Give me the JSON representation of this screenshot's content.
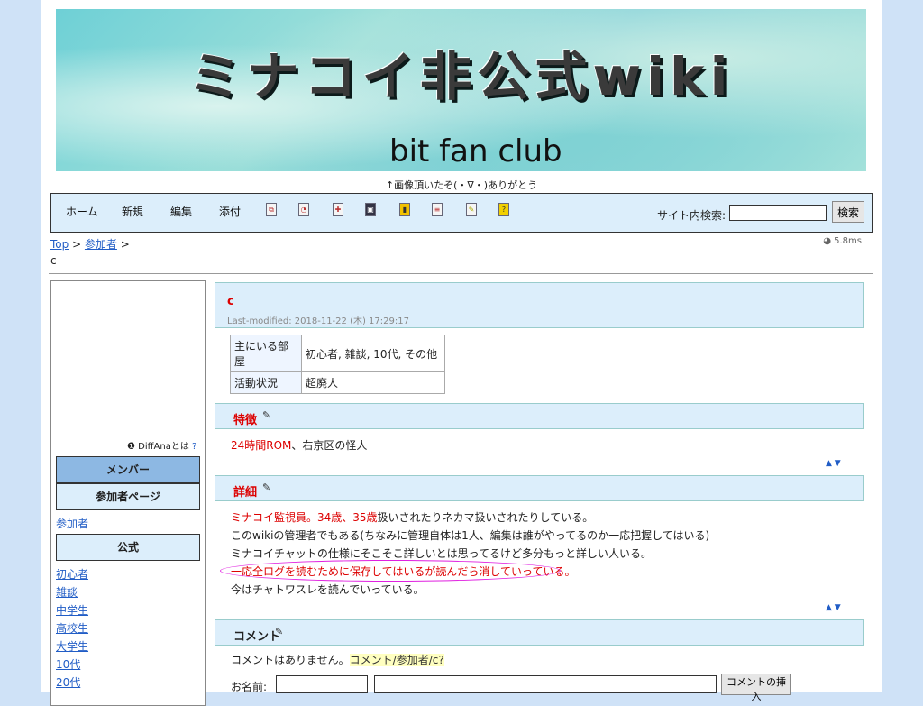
{
  "banner": {
    "title": "ミナコイ非公式wiki",
    "subtitle": "bit fan club",
    "caption": "↑画像頂いたぞ(・∇・)ありがとう"
  },
  "nav": {
    "links": [
      "ホーム",
      "新規",
      "編集",
      "添付"
    ],
    "icons": [
      "copy-icon",
      "find-icon",
      "diff-icon",
      "save-icon",
      "lock-icon",
      "list-icon",
      "recent-icon",
      "help-icon"
    ],
    "search_label": "サイト内検索:",
    "search_value": "",
    "search_button": "検索"
  },
  "breadcrumb": {
    "top": "Top",
    "sep": " > ",
    "parent": "参加者",
    "trail": " >"
  },
  "page_short": "c",
  "render_time": "5.8ms",
  "sidebar": {
    "diffana": "DiffAnaとは",
    "diffana_q": "?",
    "members_head": "メンバー",
    "members_page": "参加者ページ",
    "participant_link": "参加者",
    "official_head": "公式",
    "links": [
      "初心者",
      "雑談",
      "中学生",
      "高校生",
      "大学生",
      "10代",
      "20代"
    ]
  },
  "main": {
    "title": "c",
    "last_modified": "Last-modified: 2018-11-22 (木) 17:29:17",
    "table": [
      {
        "label": "主にいる部屋",
        "value": "初心者, 雑談, 10代, その他"
      },
      {
        "label": "活動状況",
        "value": "超廃人"
      }
    ],
    "feature_head": "特徴",
    "feature_red": "24時間ROM",
    "feature_rest": "、右京区の怪人",
    "detail_head": "詳細",
    "detail_line1_red1": "ミナコイ監視員。34歳、35歳",
    "detail_line1_rest": "扱いされたりネカマ扱いされたりしている。",
    "detail_line2": "このwikiの管理者でもある(ちなみに管理自体は1人、編集は誰がやってるのか一応把握してはいる)",
    "detail_line3": "ミナコイチャットの仕様にそこそこ詳しいとは思ってるけど多分もっと詳しい人いる。",
    "detail_line4": "一応全ログを読むために保存してはいるが読んだら消していっている。",
    "detail_line5": "今はチャトワスレを読んでいっている。",
    "arrows": "▲ ▼",
    "comment_head": "コメント",
    "comment_none": "コメントはありません。",
    "comment_link": "コメント/参加者/c?",
    "name_label": "お名前:",
    "comment_button": "コメントの挿入"
  }
}
